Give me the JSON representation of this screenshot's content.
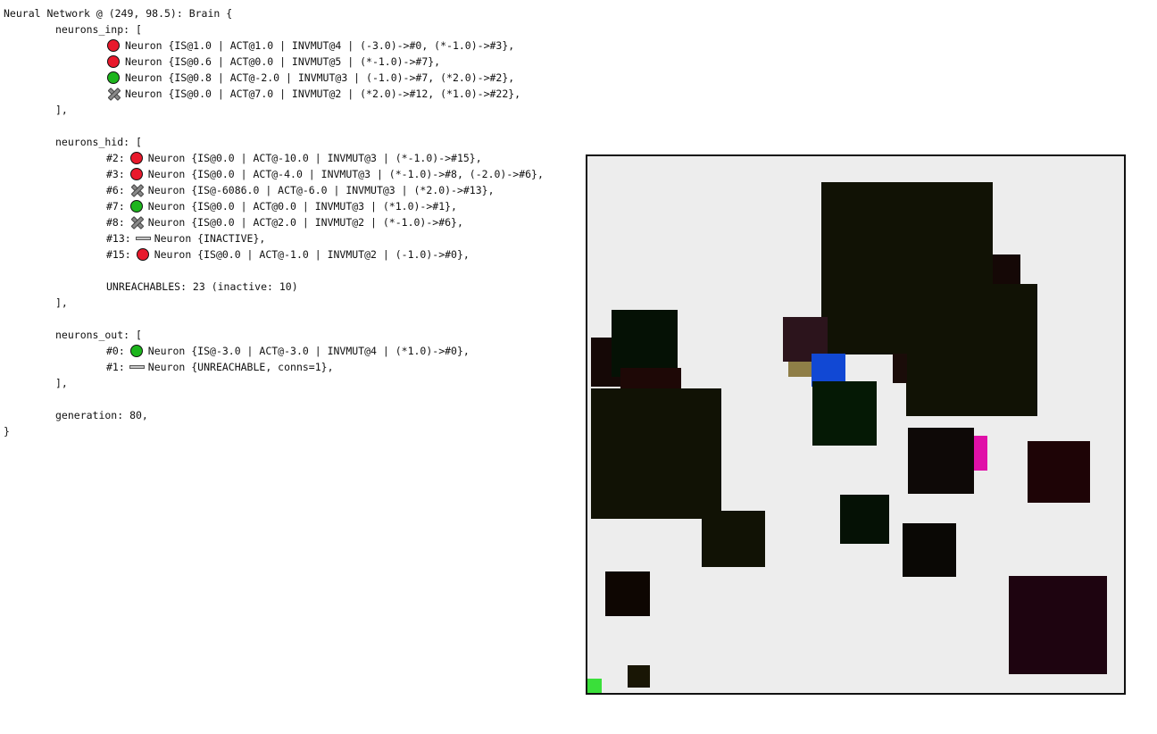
{
  "header": {
    "title": "Neural Network @ (249, 98.5): Brain {"
  },
  "inputs": {
    "open": "neurons_inp: [",
    "close": "],",
    "rows": [
      {
        "icon": "red-circle-icon",
        "text": "Neuron {IS@1.0 | ACT@1.0 | INVMUT@4 | (-3.0)->#0, (*-1.0)->#3},"
      },
      {
        "icon": "red-circle-icon",
        "text": "Neuron {IS@0.6 | ACT@0.0 | INVMUT@5 | (*-1.0)->#7},"
      },
      {
        "icon": "green-circle-icon",
        "text": "Neuron {IS@0.8 | ACT@-2.0 | INVMUT@3 | (-1.0)->#7, (*2.0)->#2},"
      },
      {
        "icon": "cross-icon",
        "text": "Neuron {IS@0.0 | ACT@7.0 | INVMUT@2 | (*2.0)->#12, (*1.0)->#22},"
      }
    ]
  },
  "hidden": {
    "open": "neurons_hid: [",
    "close": "],",
    "rows": [
      {
        "prefix": "#2:",
        "icon": "red-circle-icon",
        "text": "Neuron {IS@0.0 | ACT@-10.0 | INVMUT@3 | (*-1.0)->#15},"
      },
      {
        "prefix": "#3:",
        "icon": "red-circle-icon",
        "text": "Neuron {IS@0.0 | ACT@-4.0 | INVMUT@3 | (*-1.0)->#8, (-2.0)->#6},"
      },
      {
        "prefix": "#6:",
        "icon": "cross-icon",
        "text": "Neuron {IS@-6086.0 | ACT@-6.0 | INVMUT@3 | (*2.0)->#13},"
      },
      {
        "prefix": "#7:",
        "icon": "green-circle-icon",
        "text": "Neuron {IS@0.0 | ACT@0.0 | INVMUT@3 | (*1.0)->#1},"
      },
      {
        "prefix": "#8:",
        "icon": "cross-icon",
        "text": "Neuron {IS@0.0 | ACT@2.0 | INVMUT@2 | (*-1.0)->#6},"
      },
      {
        "prefix": "#13:",
        "icon": "inactive-bar-icon",
        "text": "Neuron {INACTIVE},"
      },
      {
        "prefix": "#15:",
        "icon": "red-circle-icon",
        "text": "Neuron {IS@0.0 | ACT@-1.0 | INVMUT@2 | (-1.0)->#0},"
      }
    ],
    "unreachables": "UNREACHABLES: 23 (inactive: 10)"
  },
  "outputs": {
    "open": "neurons_out: [",
    "close": "],",
    "rows": [
      {
        "prefix": "#0:",
        "icon": "green-circle-icon",
        "text": "Neuron {IS@-3.0 | ACT@-3.0 | INVMUT@4 | (*1.0)->#0},"
      },
      {
        "prefix": "#1:",
        "icon": "inactive-bar-icon",
        "text": "Neuron {UNREACHABLE, conns=1},"
      }
    ]
  },
  "generation": "generation: 80,",
  "footer": {
    "close": "}"
  },
  "colors": {
    "active_neuron": "#e8192c",
    "positive_neuron": "#1db51d",
    "world_background": "#ededed",
    "agent": "#1148d4",
    "marker_magenta": "#e010a8",
    "marker_green": "#3adf3a",
    "marker_olive": "#8f7e47"
  }
}
